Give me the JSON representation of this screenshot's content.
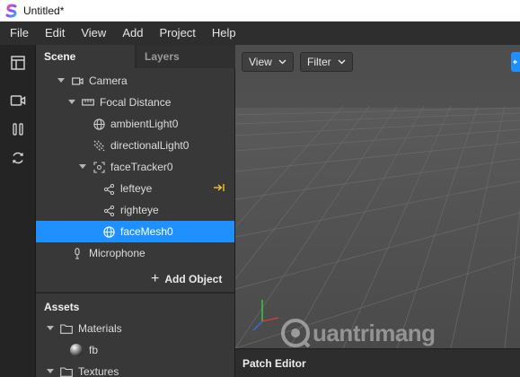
{
  "window": {
    "title": "Untitled*"
  },
  "menu": [
    "File",
    "Edit",
    "View",
    "Add",
    "Project",
    "Help"
  ],
  "panel": {
    "tabs": [
      "Scene",
      "Layers"
    ],
    "tree": [
      {
        "label": "Camera",
        "icon": "camera-icon",
        "depth": 1,
        "expanded": true
      },
      {
        "label": "Focal Distance",
        "icon": "ruler-icon",
        "depth": 2,
        "expanded": true
      },
      {
        "label": "ambientLight0",
        "icon": "globe-icon",
        "depth": 3
      },
      {
        "label": "directionalLight0",
        "icon": "directional-light-icon",
        "depth": 3
      },
      {
        "label": "faceTracker0",
        "icon": "face-tracker-icon",
        "depth": 3,
        "expanded": true
      },
      {
        "label": "lefteye",
        "icon": "node-icon",
        "depth": 4,
        "tag": "arrow-to-bar-icon"
      },
      {
        "label": "righteye",
        "icon": "node-icon",
        "depth": 4
      },
      {
        "label": "faceMesh0",
        "icon": "globe-icon",
        "depth": 4,
        "selected": true
      },
      {
        "label": "Microphone",
        "icon": "microphone-icon",
        "depth": 1
      }
    ],
    "add_object": "Add Object",
    "assets": {
      "title": "Assets",
      "items": [
        {
          "label": "Materials",
          "icon": "folder-icon",
          "expanded": true
        },
        {
          "label": "fb",
          "icon": "sphere-icon"
        },
        {
          "label": "Textures",
          "icon": "folder-icon",
          "expanded": true
        }
      ]
    }
  },
  "viewport": {
    "view_label": "View",
    "filter_label": "Filter"
  },
  "patch_editor": {
    "label": "Patch Editor"
  },
  "watermark": "uantrimang",
  "colors": {
    "selection": "#1e90ff",
    "accent_blue": "#1f8fff",
    "gizmo_x": "#e03a3a",
    "gizmo_y": "#3ad13a",
    "gizmo_z": "#2f6cf0"
  }
}
